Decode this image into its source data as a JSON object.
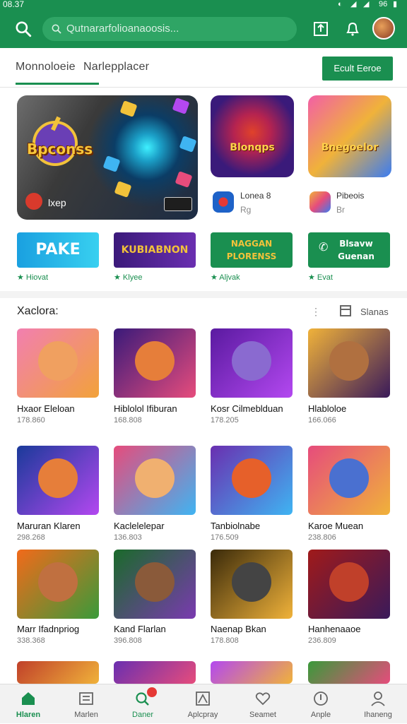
{
  "status": {
    "time": "08.37",
    "icons": [
      "wifi-icon",
      "signal-icon",
      "battery-icon"
    ],
    "battery": "96"
  },
  "appbar": {
    "search_placeholder": "Qutnararfolioanaoosis...",
    "icons": [
      "search-icon",
      "download-icon",
      "bell-icon",
      "avatar"
    ]
  },
  "tabs": [
    {
      "label": "Monnoloeie"
    },
    {
      "label": "Narlepplacer"
    }
  ],
  "games_button": "Ecult Eeroe",
  "hero": {
    "title": "Bpconss",
    "subtitle": "lxep"
  },
  "featured": [
    {
      "title": "Blonqps",
      "meta_title": "Lonea 8",
      "meta_sub": "Rg"
    },
    {
      "title": "Bnegoelor",
      "meta_title": "Pibeois",
      "meta_sub": "Br"
    }
  ],
  "banners": [
    {
      "label": "PAKE",
      "rating": "★ Hiovat"
    },
    {
      "label": "KUBIABNON",
      "rating": "★ Klyee"
    },
    {
      "label": "NAGGAN PLORENSS",
      "rating": "★ Aljvak"
    },
    {
      "label": "Blsavw Guenan",
      "rating": "★ Evat"
    }
  ],
  "section": {
    "title": "Xaclora:",
    "dots": "⋮",
    "action": "Slanas"
  },
  "games": [
    {
      "name": "Hxaor Eleloan",
      "size": "178.860"
    },
    {
      "name": "Hiblolol Ifiburan",
      "size": "168.808"
    },
    {
      "name": "Kosr Cilmeblduan",
      "size": "178.205"
    },
    {
      "name": "Hlabloloe",
      "size": "166.066"
    },
    {
      "name": "Maruran Klaren",
      "size": "298.268"
    },
    {
      "name": "Kaclelelepar",
      "size": "136.803"
    },
    {
      "name": "Tanbiolnabe",
      "size": "176.509"
    },
    {
      "name": "Karoe Muean",
      "size": "238.806"
    },
    {
      "name": "Marr Ifadnpriog",
      "size": "338.368"
    },
    {
      "name": "Kand Flarlan",
      "size": "396.808"
    },
    {
      "name": "Naenap Bkan",
      "size": "178.808"
    },
    {
      "name": "Hanhenaaoe",
      "size": "236.809"
    }
  ],
  "nav": [
    {
      "label": "Hlaren",
      "icon": "home-icon"
    },
    {
      "label": "Marlen",
      "icon": "list-icon"
    },
    {
      "label": "Daner",
      "icon": "games-icon"
    },
    {
      "label": "Aplcpray",
      "icon": "apps-icon"
    },
    {
      "label": "Seamet",
      "icon": "heart-icon"
    },
    {
      "label": "Anple",
      "icon": "compass-icon"
    },
    {
      "label": "Ihaneng",
      "icon": "account-icon"
    }
  ],
  "colors": {
    "brand": "#1a8f50",
    "brand_light": "#2fa565",
    "badge": "#e53935"
  }
}
